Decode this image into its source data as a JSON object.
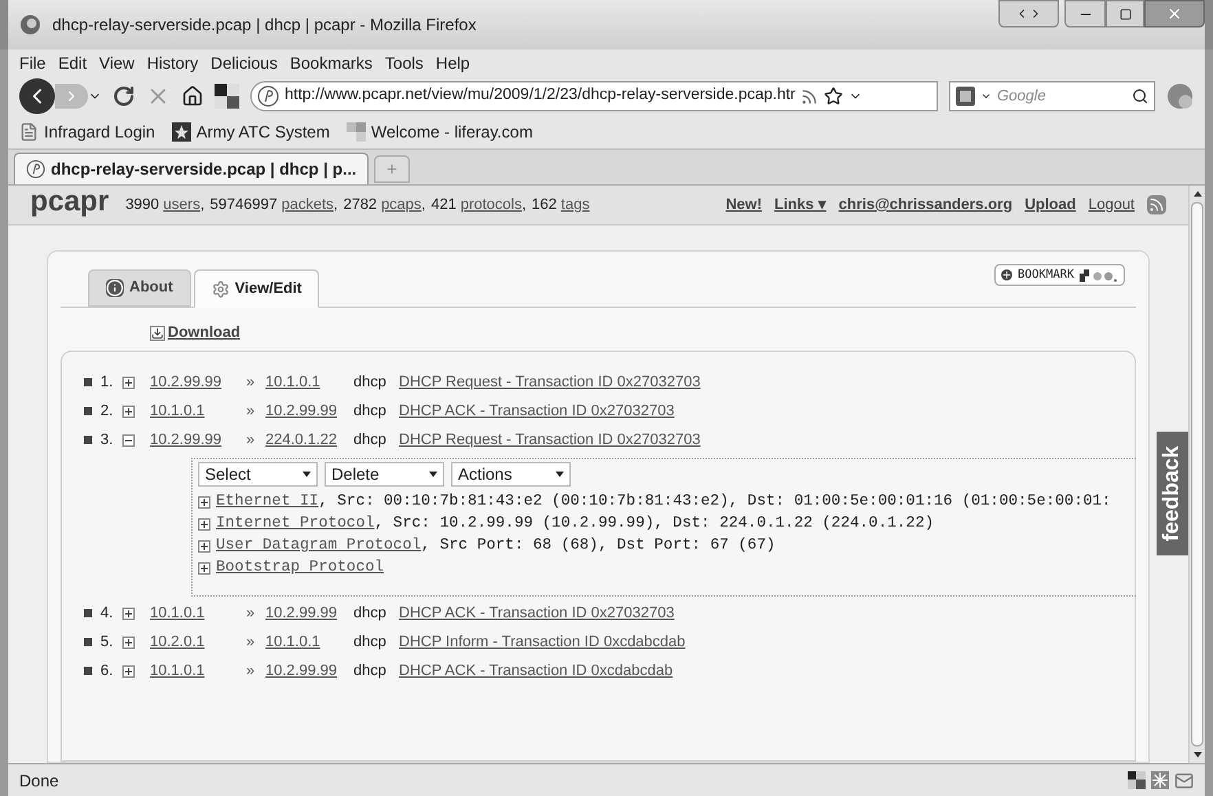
{
  "window": {
    "title": "dhcp-relay-serverside.pcap | dhcp | pcapr - Mozilla Firefox"
  },
  "menu": [
    "File",
    "Edit",
    "View",
    "History",
    "Delicious",
    "Bookmarks",
    "Tools",
    "Help"
  ],
  "navigation": {
    "url": "http://www.pcapr.net/view/mu/2009/1/2/23/dhcp-relay-serverside.pcap.htr",
    "search_placeholder": "Google"
  },
  "bookmarks": [
    "Infragard Login",
    "Army ATC System",
    "Welcome - liferay.com"
  ],
  "browser_tabs": [
    {
      "label": "dhcp-relay-serverside.pcap | dhcp | p...",
      "selected": true
    }
  ],
  "site_header": {
    "logo": "pcapr",
    "stats": [
      {
        "count": "3990",
        "link": "users",
        "sep": ","
      },
      {
        "count": "59746997",
        "link": "packets",
        "sep": ","
      },
      {
        "count": "2782",
        "link": "pcaps",
        "sep": ","
      },
      {
        "count": "421",
        "link": "protocols",
        "sep": ","
      },
      {
        "count": "162",
        "link": "tags"
      }
    ],
    "links": [
      "New!",
      "Links ▾",
      "chris@chrissanders.org",
      "Upload",
      "Logout"
    ]
  },
  "page_tabs": [
    {
      "label": "About",
      "selected": false
    },
    {
      "label": "View/Edit",
      "selected": true
    }
  ],
  "bookmark_button": "BOOKMARK",
  "download": "Download",
  "packets": [
    {
      "number": "1.",
      "expanded": false,
      "src": "10.2.99.99",
      "sep": "»",
      "dst": "10.1.0.1",
      "protocol": "dhcp",
      "summary": "DHCP Request - Transaction ID 0x27032703"
    },
    {
      "number": "2.",
      "expanded": false,
      "src": "10.1.0.1",
      "sep": "»",
      "dst": "10.2.99.99",
      "protocol": "dhcp",
      "summary": "DHCP ACK - Transaction ID 0x27032703"
    },
    {
      "number": "3.",
      "expanded": true,
      "src": "10.2.99.99",
      "sep": "»",
      "dst": "224.0.1.22",
      "protocol": "dhcp",
      "summary": "DHCP Request - Transaction ID 0x27032703",
      "detail": {
        "dropdowns": [
          "Select",
          "Delete",
          "Actions"
        ],
        "layers": [
          {
            "name": "Ethernet II",
            "info": ", Src: 00:10:7b:81:43:e2 (00:10:7b:81:43:e2), Dst: 01:00:5e:00:01:16 (01:00:5e:00:01:"
          },
          {
            "name": "Internet Protocol",
            "info": ", Src: 10.2.99.99 (10.2.99.99), Dst: 224.0.1.22 (224.0.1.22)"
          },
          {
            "name": "User Datagram Protocol",
            "info": ", Src Port: 68 (68), Dst Port: 67 (67)"
          },
          {
            "name": "Bootstrap Protocol"
          }
        ]
      }
    },
    {
      "number": "4.",
      "expanded": false,
      "src": "10.1.0.1",
      "sep": "»",
      "dst": "10.2.99.99",
      "protocol": "dhcp",
      "summary": "DHCP ACK - Transaction ID 0x27032703"
    },
    {
      "number": "5.",
      "expanded": false,
      "src": "10.2.0.1",
      "sep": "»",
      "dst": "10.1.0.1",
      "protocol": "dhcp",
      "summary": "DHCP Inform - Transaction ID 0xcdabcdab"
    },
    {
      "number": "6.",
      "expanded": false,
      "src": "10.1.0.1",
      "sep": "»",
      "dst": "10.2.99.99",
      "protocol": "dhcp",
      "summary": "DHCP ACK - Transaction ID 0xcdabcdab"
    }
  ],
  "feedback": "feedback",
  "status_bar": {
    "text": "Done"
  }
}
